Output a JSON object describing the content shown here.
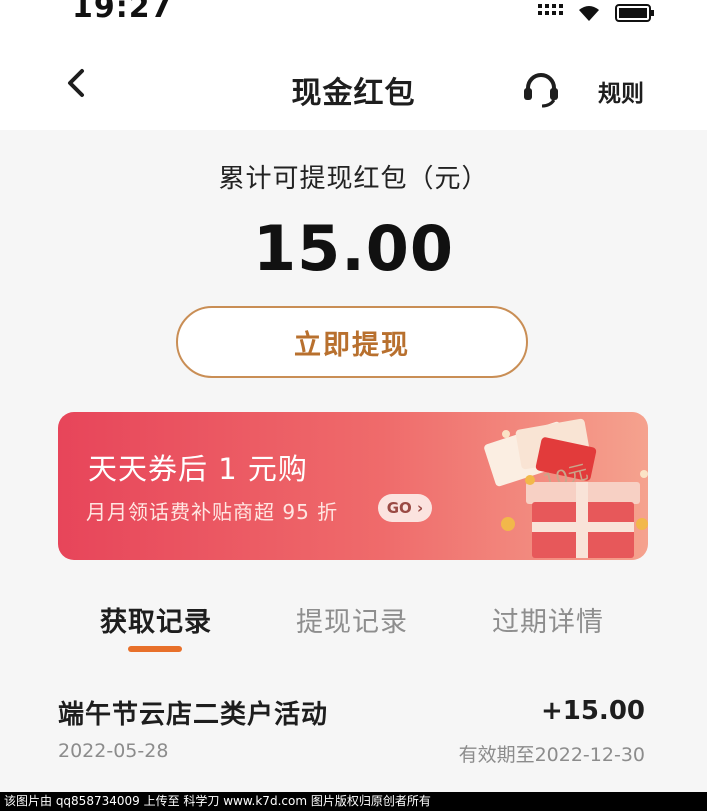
{
  "status_bar": {
    "time": "19:27",
    "signal_icon": "signal-icon",
    "wifi_icon": "wifi-icon",
    "battery_icon": "battery-icon"
  },
  "nav": {
    "back_icon": "back-arrow-icon",
    "title": "现金红包",
    "service_icon": "headset-icon",
    "rules_label": "规则"
  },
  "balance": {
    "label": "累计可提现红包（元）",
    "amount": "15.00",
    "withdraw_button": "立即提现"
  },
  "promo": {
    "title": "天天券后 1 元购",
    "subtitle": "月月领话费补贴商超 95 折",
    "go_label": "GO",
    "gift_icon": "gift-box-icon",
    "coupon_text": "10元",
    "colors": {
      "start": "#e7455a",
      "end": "#f5a28e"
    }
  },
  "tabs": [
    {
      "label": "获取记录",
      "active": true
    },
    {
      "label": "提现记录",
      "active": false
    },
    {
      "label": "过期详情",
      "active": false
    }
  ],
  "records": [
    {
      "title": "端午节云店二类户活动",
      "amount": "+15.00",
      "date": "2022-05-28",
      "expiry": "有效期至2022-12-30"
    }
  ],
  "watermark": "该图片由 qq858734009 上传至 科学刀 www.k7d.com 图片版权归原创者所有",
  "colors": {
    "accent": "#e8702a",
    "button_border": "#c98e55",
    "button_text": "#b8702e"
  }
}
